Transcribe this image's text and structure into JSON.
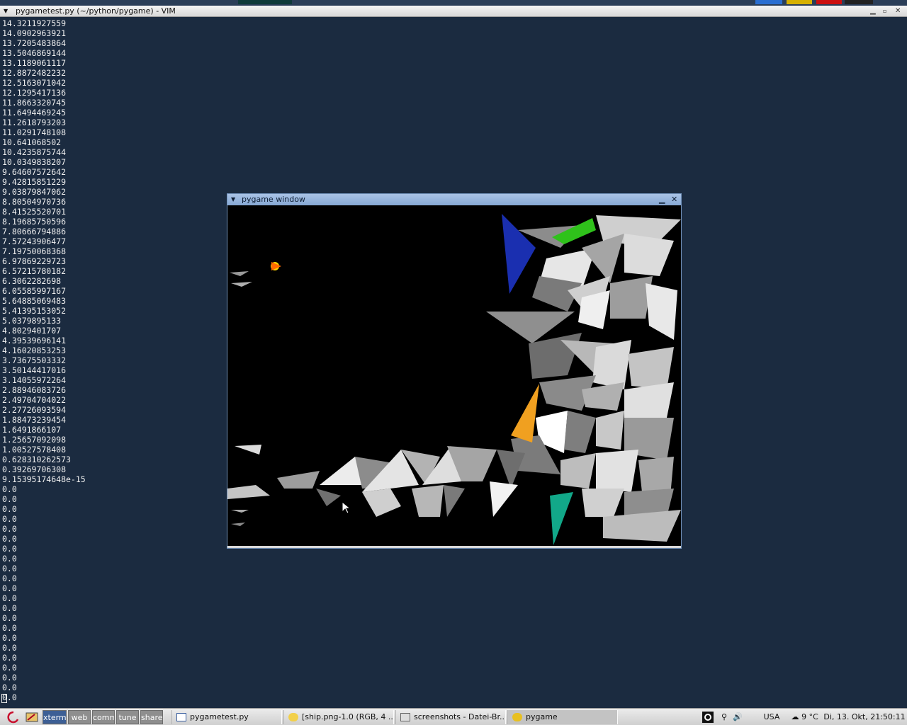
{
  "vim_window": {
    "title": "pygametest.py (~/python/pygame) - VIM",
    "menu_icon": "triangle-down-icon",
    "controls": [
      "minimize-icon",
      "maximize-icon",
      "close-icon"
    ]
  },
  "terminal": {
    "lines": [
      "14.3211927559",
      "14.0902963921",
      "13.7205483864",
      "13.5046869144",
      "13.1189061117",
      "12.8872482232",
      "12.5163071042",
      "12.1295417136",
      "11.8663320745",
      "11.6494469245",
      "11.2618793203",
      "11.0291748108",
      "10.641068502",
      "10.4235875744",
      "10.0349838207",
      "9.64607572642",
      "9.42815851229",
      "9.03879847062",
      "8.80504970736",
      "8.41525520701",
      "8.19685750596",
      "7.80666794886",
      "7.57243906477",
      "7.19750068368",
      "6.97869229723",
      "6.57215780182",
      "6.3062282698",
      "6.05585997167",
      "5.64885069483",
      "5.41395153052",
      "5.0379895133",
      "4.8029401707",
      "4.39539696141",
      "4.16020853253",
      "3.73675503332",
      "3.50144417016",
      "3.14055972264",
      "2.88946083726",
      "2.49704704022",
      "2.27726093594",
      "1.88473239454",
      "1.6491866107",
      "1.25657092098",
      "1.00527578408",
      "0.628310262573",
      "0.39269706308",
      "9.15395174648e-15",
      "0.0",
      "0.0",
      "0.0",
      "0.0",
      "0.0",
      "0.0",
      "0.0",
      "0.0",
      "0.0",
      "0.0",
      "0.0",
      "0.0",
      "0.0",
      "0.0",
      "0.0",
      "0.0",
      "0.0",
      "0.0",
      "0.0",
      "0.0",
      "0.0",
      "0.0"
    ]
  },
  "pygame_window": {
    "title": "pygame window",
    "menu_icon": "triangle-down-icon",
    "controls": [
      "minimize-icon",
      "close-icon"
    ],
    "colors": {
      "background": "#000000",
      "blue_prism": "#1a2fb0",
      "green_prism": "#2fc21b",
      "orange_cone": "#f0a020",
      "teal_shard": "#12a889",
      "ship": "#ffd400",
      "rocks": [
        "#ffffff",
        "#d0d0d0",
        "#a0a0a0",
        "#707070",
        "#4a4a4a"
      ]
    }
  },
  "taskbar": {
    "start_icon": "debian-swirl-icon",
    "workspaces": [
      {
        "label": "xterm",
        "active": true
      },
      {
        "label": "web",
        "active": false
      },
      {
        "label": "comm",
        "active": false
      },
      {
        "label": "tune",
        "active": false
      },
      {
        "label": "share",
        "active": false
      }
    ],
    "tasks": [
      {
        "label": "pygametest.py",
        "icon": "editor-window-icon",
        "active": false
      },
      {
        "label": "[ship.png-1.0 (RGB, 4 ...",
        "icon": "gimp-icon",
        "active": false
      },
      {
        "label": "screenshots - Datei-Br...",
        "icon": "file-manager-icon",
        "active": false
      },
      {
        "label": "pygame",
        "icon": "python-snake-icon",
        "active": true
      }
    ],
    "tray": {
      "keyboard_layout": "USA",
      "temperature": "9 °C",
      "weather_icon": "cloud-rain-icon",
      "datetime": "Di, 13. Okt, 21:50:11"
    }
  }
}
